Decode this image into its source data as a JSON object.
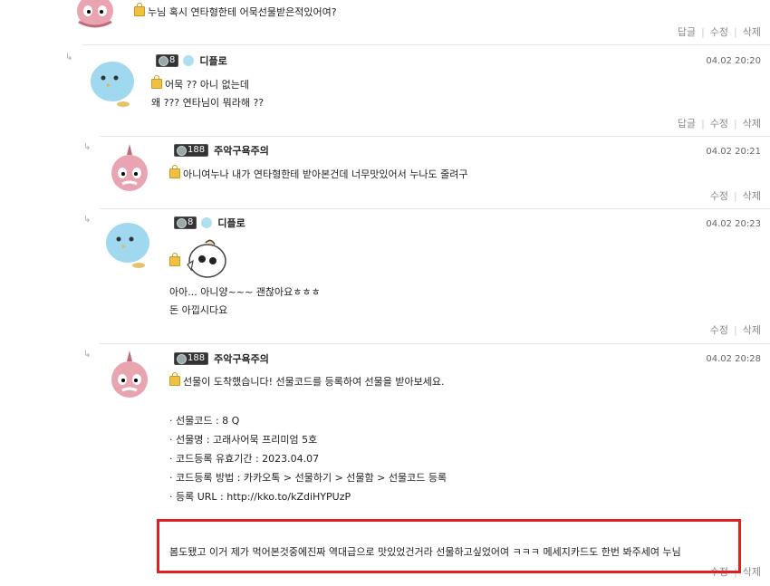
{
  "comments": [
    {
      "text_lines": [
        "누님 혹시 연타형한테 어묵선물받은적있어여?"
      ],
      "actions": [
        "답글",
        "수정",
        "삭제"
      ]
    },
    {
      "badge": "8",
      "nick": "디플로",
      "date": "04.02 20:20",
      "text_lines": [
        "어묵 ?? 아니 없는데",
        "왜 ??? 연타님이 뭐라해 ??"
      ],
      "actions": [
        "답글",
        "수정",
        "삭제"
      ]
    },
    {
      "badge": "188",
      "nick": "주악구욕주의",
      "date": "04.02 20:21",
      "text_lines": [
        "아니여누나 내가 연타형한테 받아본건데 너무맛있어서 누나도 줄려구"
      ],
      "actions": [
        "수정",
        "삭제"
      ]
    },
    {
      "badge": "8",
      "nick": "디플로",
      "date": "04.02 20:23",
      "text_lines": [
        "아아... 아니양~~~ 괜찮아요ㅎㅎㅎ",
        "돈 아낍시다요"
      ],
      "actions": [
        "수정",
        "삭제"
      ]
    },
    {
      "badge": "188",
      "nick": "주악구욕주의",
      "date": "04.02 20:28",
      "text_lines": [
        "선물이 도착했습니다! 선물코드를 등록하여 선물을 받아보세요."
      ],
      "gift_lines": [
        "· 선물코드 : 8                Q",
        "· 선물명 : 고래사어묵 프리미엄 5호",
        "· 코드등록 유효기간 : 2023.04.07",
        "· 코드등록 방법 : 카카오톡 > 선물하기 > 선물함 > 선물코드 등록",
        "· 등록 URL : http://kko.to/kZdiHYPUzP"
      ],
      "highlight": "봄도됐고 이거 제가 먹어본것중에진짜 역대급으로 맛있었건거라 선물하고싶었어여 ㅋㅋㅋ 메세지카드도 한번 봐주세여 누님",
      "actions": [
        "수정",
        "삭제"
      ]
    }
  ],
  "colors": {
    "highlight_border": "#e02020",
    "divider": "#e6e6e6"
  }
}
